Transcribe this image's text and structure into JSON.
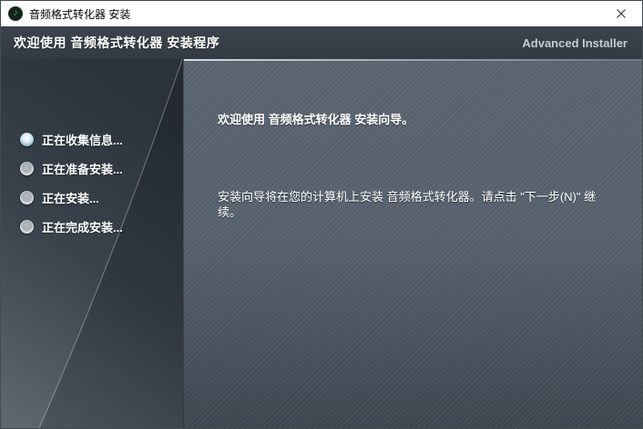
{
  "window": {
    "title": "音频格式转化器 安装",
    "app_icon_glyph": "♪"
  },
  "header": {
    "title": "欢迎使用 音频格式转化器 安装程序",
    "brand": "Advanced Installer"
  },
  "sidebar": {
    "steps": [
      {
        "label": "正在收集信息...",
        "active": true
      },
      {
        "label": "正在准备安装...",
        "active": false
      },
      {
        "label": "正在安装...",
        "active": false
      },
      {
        "label": "正在完成安装...",
        "active": false
      }
    ]
  },
  "main": {
    "heading": "欢迎使用 音频格式转化器 安装向导。",
    "body": "安装向导将在您的计算机上安装 音频格式转化器。请点击 \"下一步(N)\" 继续。"
  },
  "colors": {
    "header_bg": "#363d46",
    "brand_text": "#c6cbd1",
    "active_step": "#9fc3d8",
    "main_bg_top": "#5a6470",
    "main_bg_bottom": "#3e4650",
    "sidebar_dark": "#2b323a",
    "sidebar_light": "#5d666f"
  }
}
